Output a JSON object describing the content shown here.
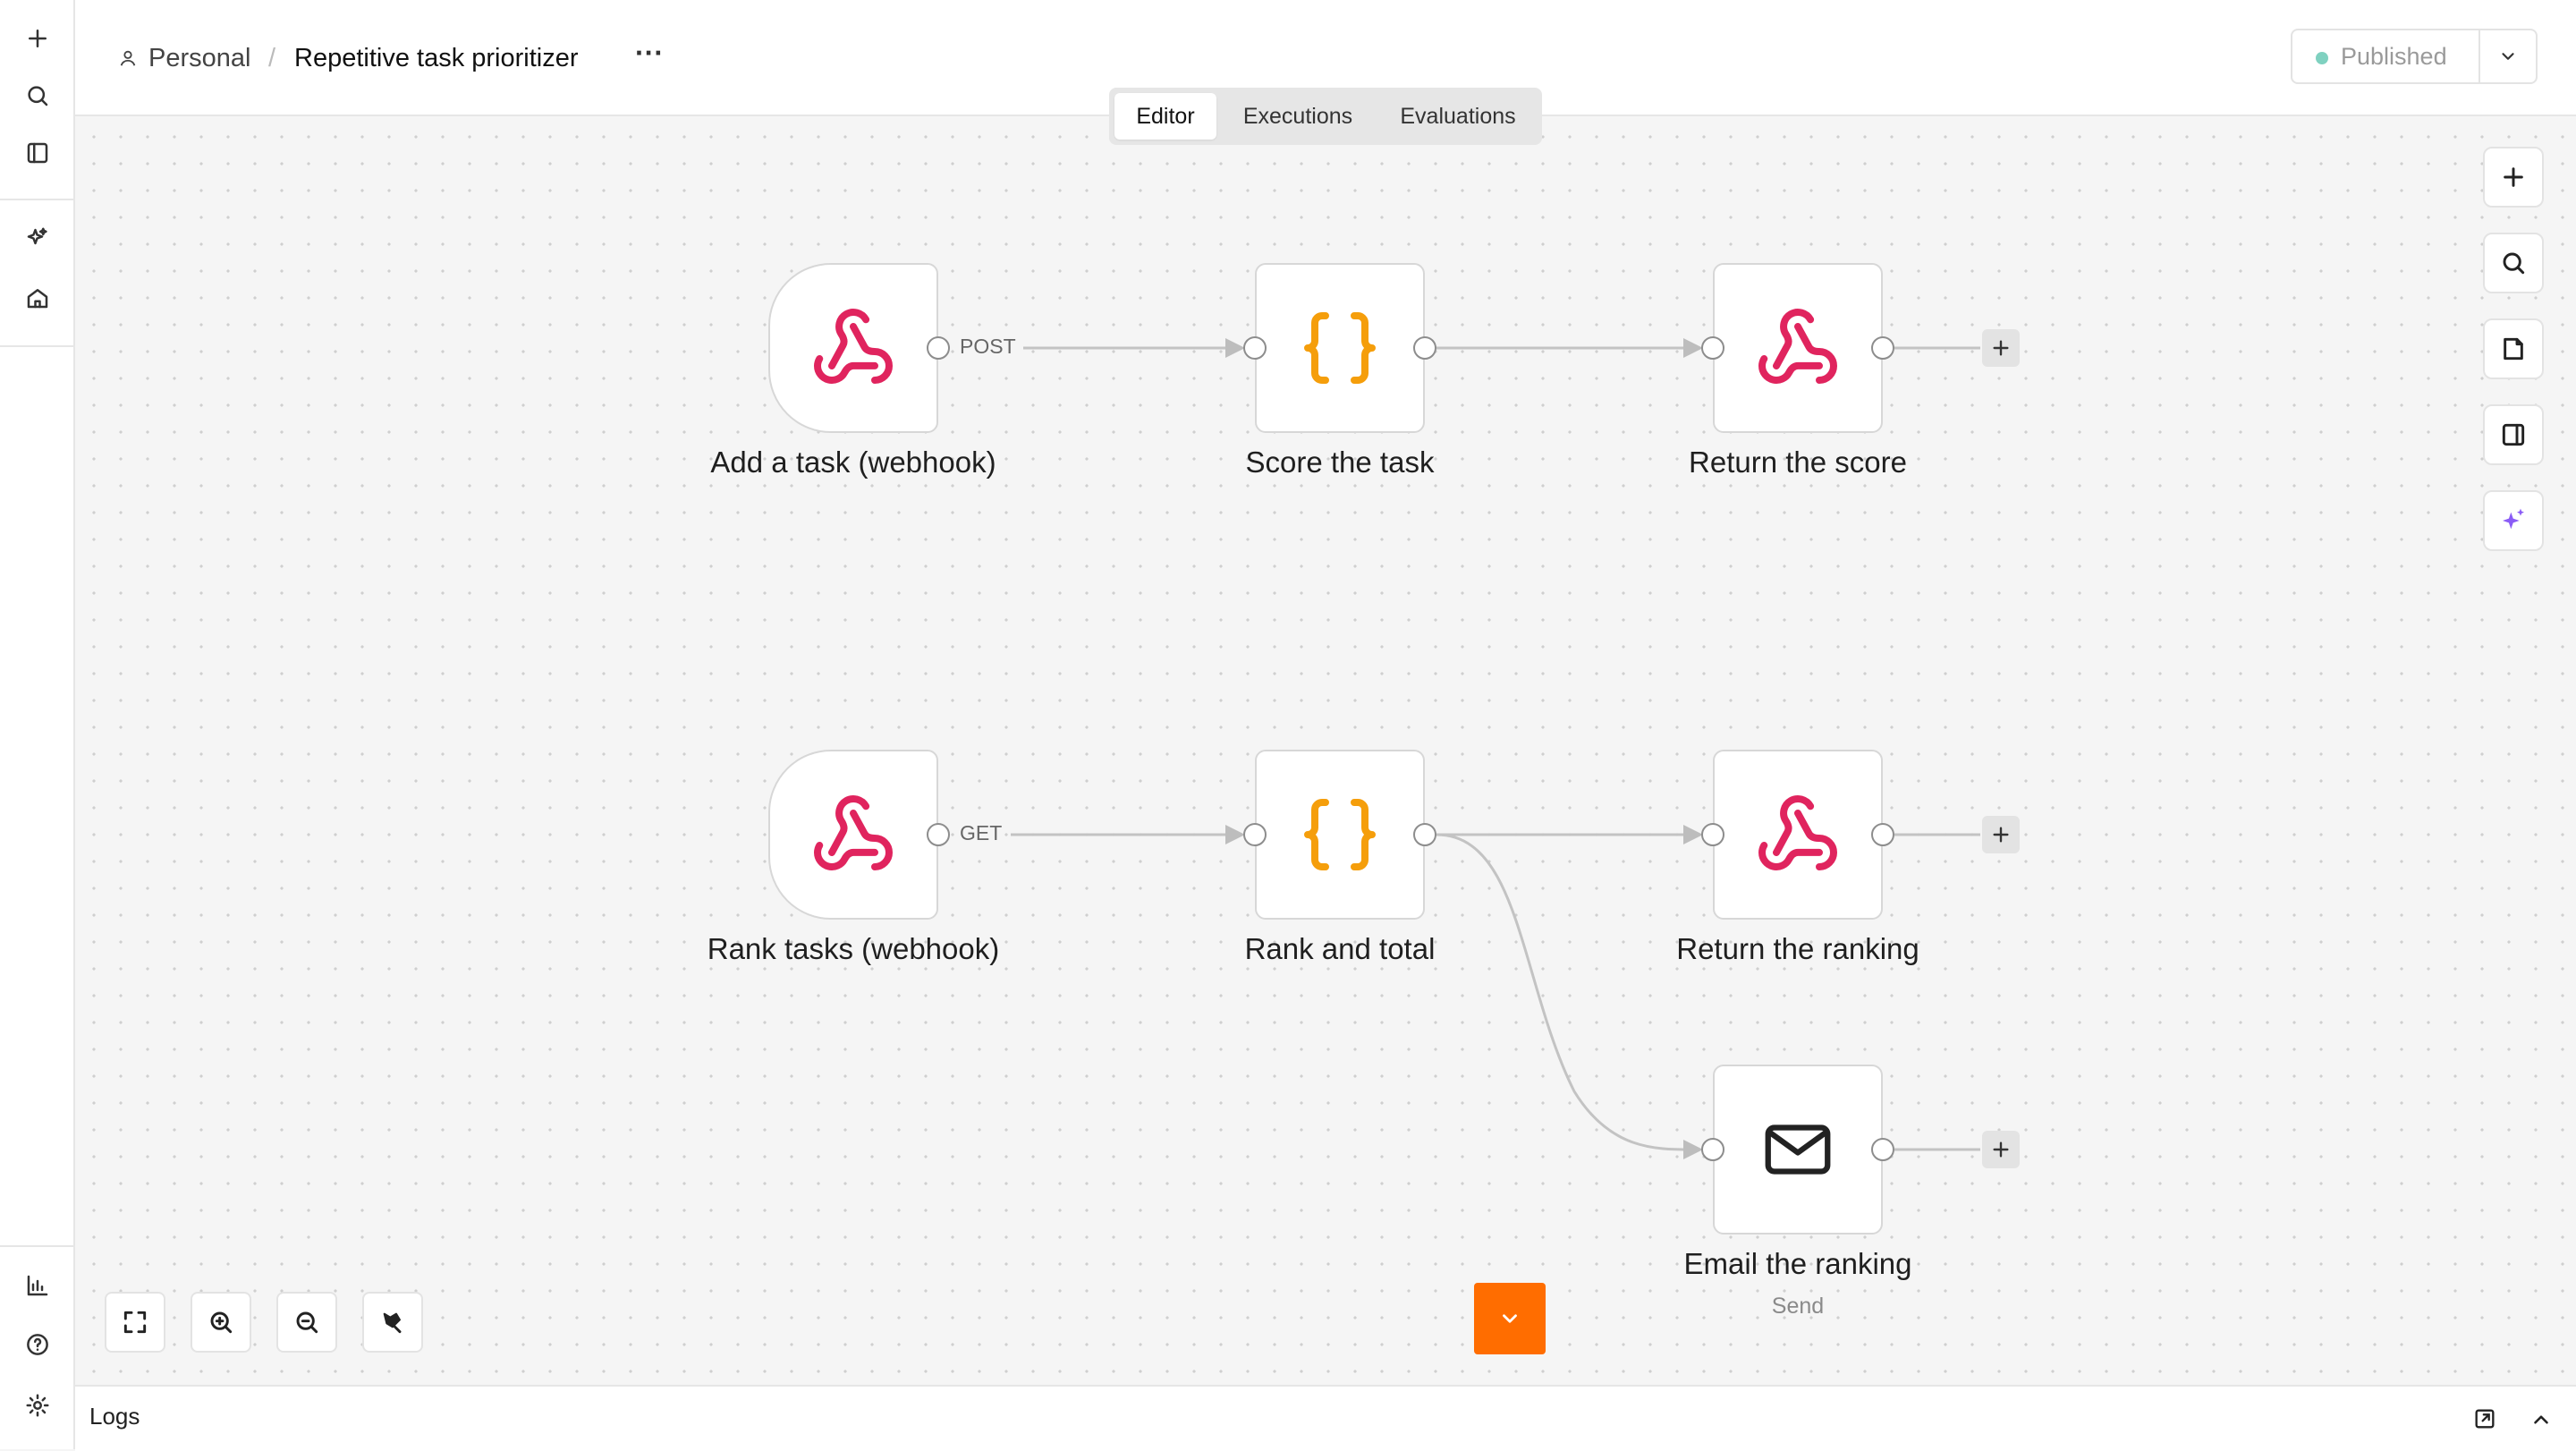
{
  "header": {
    "project": "Personal",
    "separator": "/",
    "workflow_name": "Repetitive task prioritizer",
    "more_label": "···",
    "publish_status": "Published"
  },
  "tabs": [
    {
      "label": "Editor",
      "active": true
    },
    {
      "label": "Executions",
      "active": false
    },
    {
      "label": "Evaluations",
      "active": false
    }
  ],
  "nodes": [
    {
      "name": "Add a task (webhook)",
      "icon": "webhook-icon"
    },
    {
      "name": "Score the task",
      "icon": "code-braces-icon"
    },
    {
      "name": "Return the score",
      "icon": "webhook-icon"
    },
    {
      "name": "Rank tasks (webhook)",
      "icon": "webhook-icon"
    },
    {
      "name": "Rank and total",
      "icon": "code-braces-icon"
    },
    {
      "name": "Return the ranking",
      "icon": "webhook-icon"
    },
    {
      "name": "Email the ranking",
      "subtitle": "Send",
      "icon": "envelope-icon"
    }
  ],
  "connections": [
    {
      "label": "POST"
    },
    {
      "label": "GET"
    }
  ],
  "footer": {
    "logs_label": "Logs"
  },
  "colors": {
    "webhook": "#e0245e",
    "code": "#f59e0b",
    "accent": "#ff6d00",
    "ai": "#8b5cf6",
    "published_dot": "#7fd1c0"
  }
}
